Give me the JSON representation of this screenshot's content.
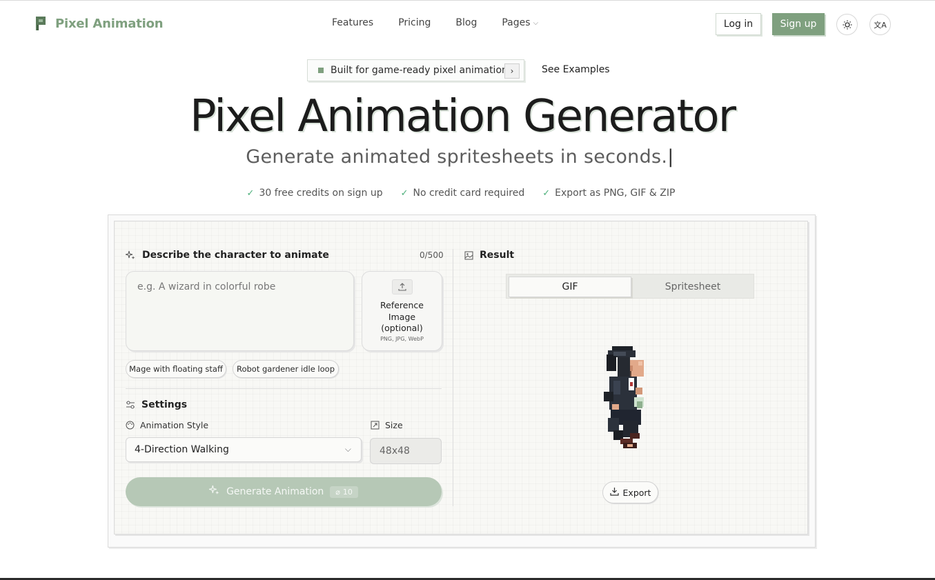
{
  "nav": {
    "brand": "Pixel Animation",
    "links": [
      "Features",
      "Pricing",
      "Blog",
      "Pages"
    ],
    "login": "Log in",
    "signup": "Sign up"
  },
  "hero": {
    "pill_text": "Built for game-ready pixel animation",
    "see_examples": "See Examples",
    "title": "Pixel Animation Generator",
    "subtitle": "Generate animated spritesheets in seconds.",
    "benefits": [
      "30 free credits on sign up",
      "No credit card required",
      "Export as PNG, GIF & ZIP"
    ]
  },
  "form": {
    "describe_label": "Describe the character to animate",
    "counter": "0/500",
    "prompt_placeholder": "e.g. A wizard in colorful robe",
    "reference_label": "Reference Image (optional)",
    "reference_formats": "PNG, JPG, WebP",
    "suggestions": [
      "Mage with floating staff",
      "Robot gardener idle loop"
    ],
    "settings_label": "Settings",
    "style_label": "Animation Style",
    "style_value": "4-Direction Walking",
    "size_label": "Size",
    "size_value": "48x48",
    "generate_label": "Generate Animation",
    "generate_cost": "10"
  },
  "result": {
    "label": "Result",
    "tabs": [
      "GIF",
      "Spritesheet"
    ],
    "active_tab": "GIF",
    "export": "Export"
  },
  "icons": {
    "logo": "pixel-p-logo-icon",
    "theme": "sun-icon",
    "language": "translate-icon",
    "sparkle": "sparkle-icon",
    "upload": "upload-icon",
    "settings": "sliders-icon",
    "palette": "palette-icon",
    "size": "resize-icon",
    "image": "image-icon",
    "download": "download-icon",
    "credit": "coin-icon"
  },
  "colors": {
    "accent": "#7fa07f",
    "accent_disabled": "#b6c8b6",
    "check": "#4caf7a"
  }
}
